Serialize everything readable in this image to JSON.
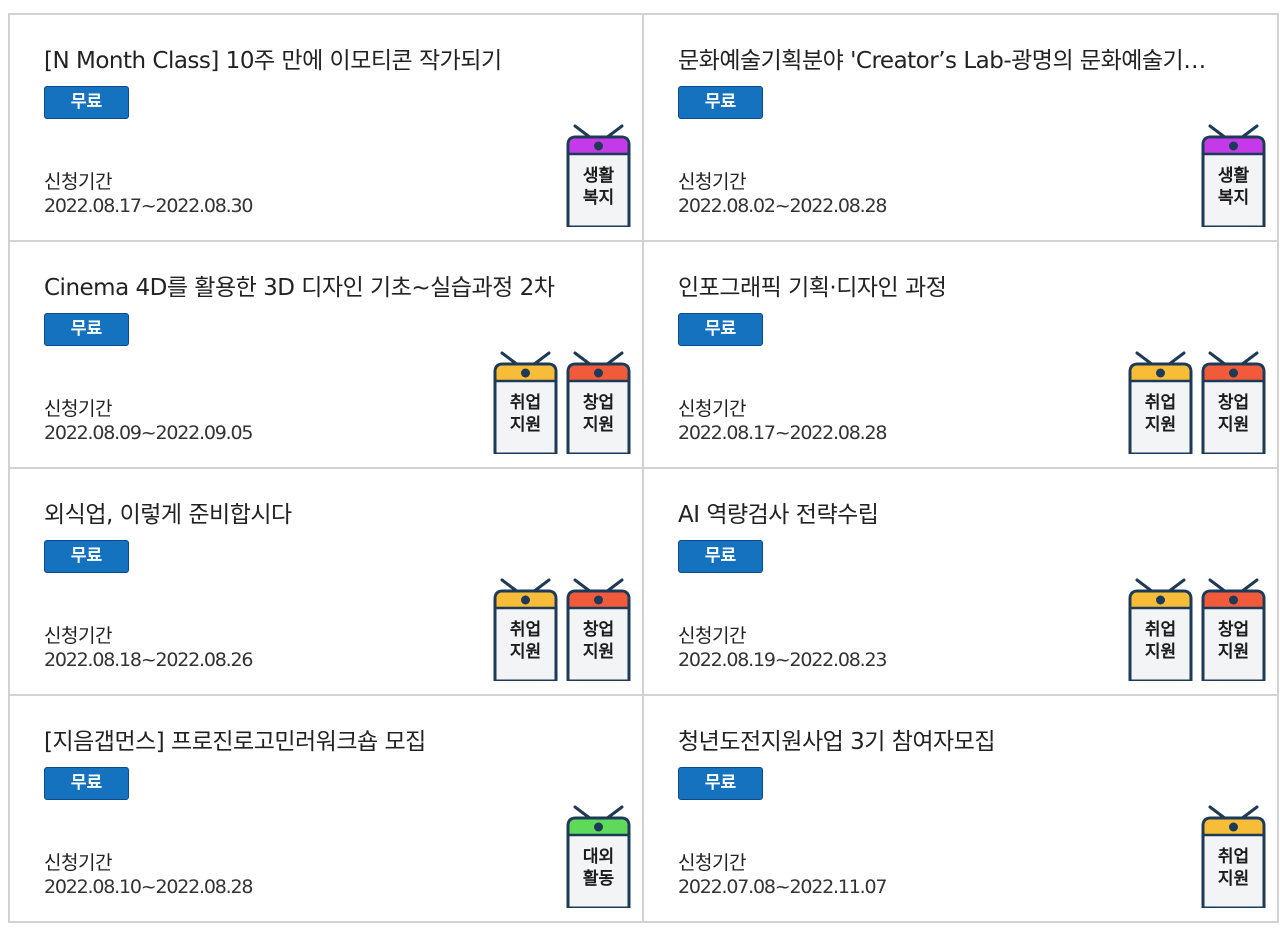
{
  "colors": {
    "badge_bg": "#1572be",
    "tag_life": "#c53ae8",
    "tag_job": "#f7bc38",
    "tag_startup": "#f25a3c",
    "tag_activity": "#5fd95a",
    "tag_outline": "#1d3a57"
  },
  "programs": [
    {
      "title": "[N Month Class] 10주 만에 이모티콘 작가되기",
      "badge": "무료",
      "period_label": "신청기간",
      "period": "2022.08.17~2022.08.30",
      "tags": [
        {
          "label": "생활\n복지",
          "color": "#c53ae8",
          "icon": "hanging-sign-icon"
        }
      ]
    },
    {
      "title": "문화예술기획분야 'Creator’s Lab-광명의 문화예술기…",
      "badge": "무료",
      "period_label": "신청기간",
      "period": "2022.08.02~2022.08.28",
      "tags": [
        {
          "label": "생활\n복지",
          "color": "#c53ae8",
          "icon": "hanging-sign-icon"
        }
      ]
    },
    {
      "title": "Cinema 4D를 활용한 3D 디자인 기초~실습과정 2차",
      "badge": "무료",
      "period_label": "신청기간",
      "period": "2022.08.09~2022.09.05",
      "tags": [
        {
          "label": "취업\n지원",
          "color": "#f7bc38",
          "icon": "hanging-sign-icon"
        },
        {
          "label": "창업\n지원",
          "color": "#f25a3c",
          "icon": "hanging-sign-icon"
        }
      ]
    },
    {
      "title": "인포그래픽 기획·디자인 과정",
      "badge": "무료",
      "period_label": "신청기간",
      "period": "2022.08.17~2022.08.28",
      "tags": [
        {
          "label": "취업\n지원",
          "color": "#f7bc38",
          "icon": "hanging-sign-icon"
        },
        {
          "label": "창업\n지원",
          "color": "#f25a3c",
          "icon": "hanging-sign-icon"
        }
      ]
    },
    {
      "title": "외식업, 이렇게 준비합시다",
      "badge": "무료",
      "period_label": "신청기간",
      "period": "2022.08.18~2022.08.26",
      "tags": [
        {
          "label": "취업\n지원",
          "color": "#f7bc38",
          "icon": "hanging-sign-icon"
        },
        {
          "label": "창업\n지원",
          "color": "#f25a3c",
          "icon": "hanging-sign-icon"
        }
      ]
    },
    {
      "title": "AI 역량검사 전략수립",
      "badge": "무료",
      "period_label": "신청기간",
      "period": "2022.08.19~2022.08.23",
      "tags": [
        {
          "label": "취업\n지원",
          "color": "#f7bc38",
          "icon": "hanging-sign-icon"
        },
        {
          "label": "창업\n지원",
          "color": "#f25a3c",
          "icon": "hanging-sign-icon"
        }
      ]
    },
    {
      "title": "[지음갭먼스] 프로진로고민러워크숍 모집",
      "badge": "무료",
      "period_label": "신청기간",
      "period": "2022.08.10~2022.08.28",
      "tags": [
        {
          "label": "대외\n활동",
          "color": "#5fd95a",
          "icon": "hanging-sign-icon"
        }
      ]
    },
    {
      "title": "청년도전지원사업 3기 참여자모집",
      "badge": "무료",
      "period_label": "신청기간",
      "period": "2022.07.08~2022.11.07",
      "tags": [
        {
          "label": "취업\n지원",
          "color": "#f7bc38",
          "icon": "hanging-sign-icon"
        }
      ]
    }
  ]
}
